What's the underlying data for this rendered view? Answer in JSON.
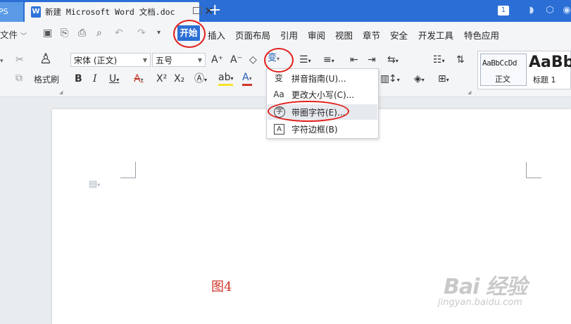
{
  "titlebar": {
    "prev_tab_label": "PS",
    "doc_tab": {
      "title": "新建 Microsoft Word 文档.doc",
      "app_icon": "word-icon",
      "close_icon": "close-icon"
    },
    "add_tab_icon": "plus-icon",
    "window_count": "1",
    "accent_color": "#2b6fd6"
  },
  "menubar": {
    "file_label": "文件",
    "items": [
      "开始",
      "插入",
      "页面布局",
      "引用",
      "审阅",
      "视图",
      "章节",
      "安全",
      "开发工具",
      "特色应用"
    ],
    "active_item": "开始"
  },
  "ribbon": {
    "format_painter_label": "格式刷",
    "font_name": "宋体 (正文)",
    "font_size": "五号",
    "styles": [
      {
        "preview": "AaBbCcDd",
        "label": "正文"
      },
      {
        "preview": "AaBb",
        "label": "标题 1"
      }
    ]
  },
  "dropdown": {
    "items": [
      {
        "label": "拼音指南(U)...",
        "icon": "pinyin-guide-icon",
        "icon_glyph": "变"
      },
      {
        "label": "更改大小写(C)...",
        "icon": "change-case-icon",
        "icon_glyph": "Aa"
      },
      {
        "label": "带圈字符(E)...",
        "icon": "enclosed-character-icon",
        "icon_glyph": "字"
      },
      {
        "label": "字符边框(B)",
        "icon": "character-border-icon",
        "icon_glyph": "A"
      }
    ],
    "highlighted_index": 2
  },
  "document": {
    "caption": "图4",
    "caption_color": "#d0352b"
  },
  "watermark": {
    "text": "Bai 经验",
    "subtext": "jingyan.baidu.com"
  },
  "annotation_color": "#e0201b"
}
